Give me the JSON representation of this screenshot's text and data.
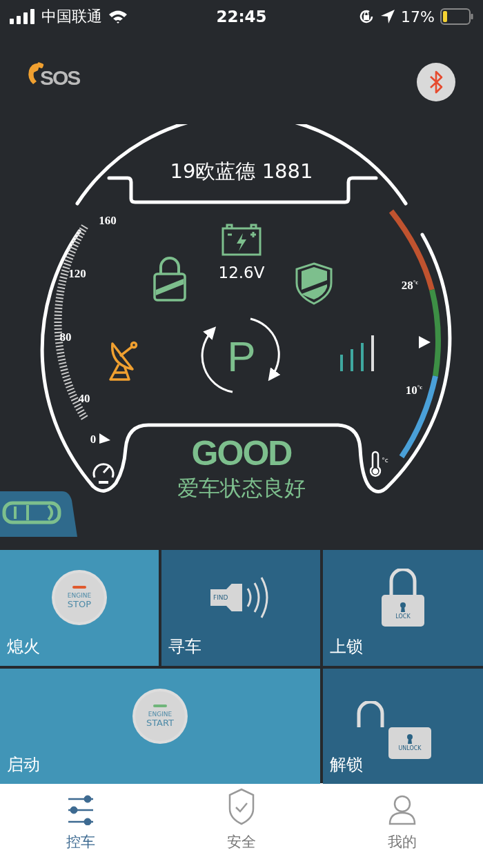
{
  "status_bar": {
    "carrier": "中国联通",
    "time": "22:45",
    "battery": "17%"
  },
  "header": {
    "sos": "SOS"
  },
  "dashboard": {
    "plate": "19欧蓝德 1881",
    "voltage": "12.6V",
    "gear": "P",
    "speed_labels": [
      "160",
      "120",
      "80",
      "40",
      "0"
    ],
    "temp_labels": [
      "28$^{°c}$",
      "10$^{°c}$"
    ],
    "thermo_unit": "°c",
    "status": "GOOD",
    "status_text": "爱车状态良好"
  },
  "controls": [
    {
      "label": "熄火",
      "kind": "engine-stop",
      "icon_text": [
        "ENGINE",
        "STOP"
      ],
      "color": "#4195b7",
      "wide": false
    },
    {
      "label": "寻车",
      "kind": "find",
      "icon_text": [
        "FIND"
      ],
      "color": "#2b6384",
      "wide": false
    },
    {
      "label": "上锁",
      "kind": "lock",
      "icon_text": [
        "LOCK"
      ],
      "color": "#2b6384",
      "wide": false
    },
    {
      "label": "启动",
      "kind": "engine-start",
      "icon_text": [
        "ENGINE",
        "START"
      ],
      "color": "#4195b7",
      "wide": true
    },
    {
      "label": "解锁",
      "kind": "unlock",
      "icon_text": [
        "UNLOCK"
      ],
      "color": "#2b6384",
      "wide": false
    }
  ],
  "tabs": [
    {
      "label": "控车",
      "kind": "sliders",
      "selected": true
    },
    {
      "label": "安全",
      "kind": "shield",
      "selected": false
    },
    {
      "label": "我的",
      "kind": "person",
      "selected": false
    }
  ]
}
